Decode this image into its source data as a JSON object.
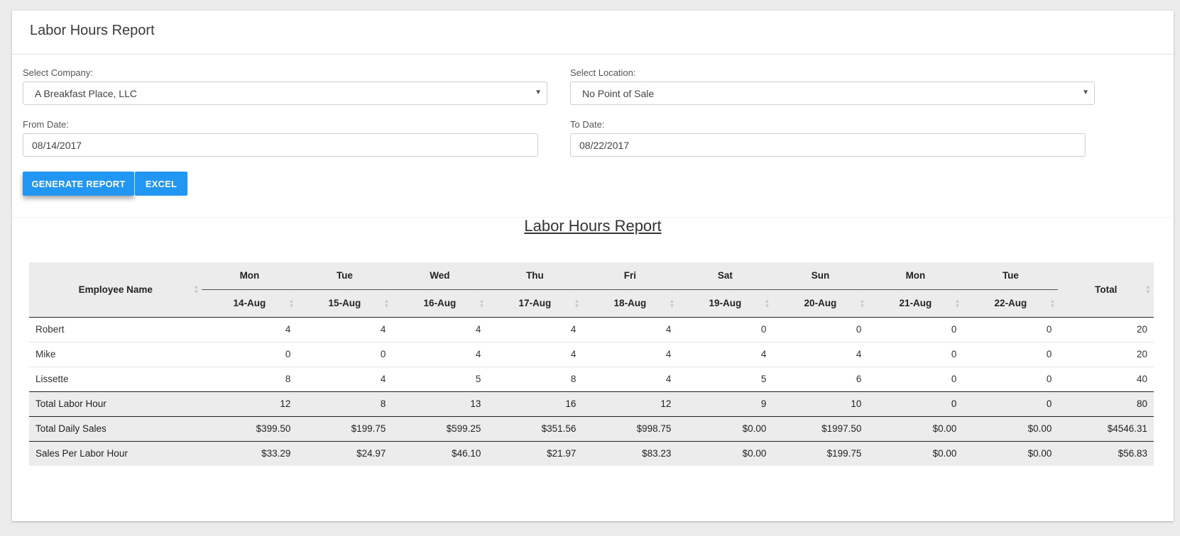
{
  "header": {
    "title": "Labor Hours Report"
  },
  "form": {
    "company_label": "Select Company:",
    "company_value": "A Breakfast Place, LLC",
    "location_label": "Select Location:",
    "location_value": "No Point of Sale",
    "from_label": "From Date:",
    "from_value": "08/14/2017",
    "to_label": "To Date:",
    "to_value": "08/22/2017",
    "generate_label": "GENERATE REPORT",
    "excel_label": "EXCEL"
  },
  "report": {
    "title": "Labor Hours Report",
    "employee_header": "Employee Name",
    "total_header": "Total",
    "days": [
      "Mon",
      "Tue",
      "Wed",
      "Thu",
      "Fri",
      "Sat",
      "Sun",
      "Mon",
      "Tue"
    ],
    "dates": [
      "14-Aug",
      "15-Aug",
      "16-Aug",
      "17-Aug",
      "18-Aug",
      "19-Aug",
      "20-Aug",
      "21-Aug",
      "22-Aug"
    ],
    "rows": [
      {
        "name": "Robert",
        "values": [
          "4",
          "4",
          "4",
          "4",
          "4",
          "0",
          "0",
          "0",
          "0"
        ],
        "total": "20"
      },
      {
        "name": "Mike",
        "values": [
          "0",
          "0",
          "4",
          "4",
          "4",
          "4",
          "4",
          "0",
          "0"
        ],
        "total": "20"
      },
      {
        "name": "Lissette",
        "values": [
          "8",
          "4",
          "5",
          "8",
          "4",
          "5",
          "6",
          "0",
          "0"
        ],
        "total": "40"
      }
    ],
    "summary": [
      {
        "name": "Total Labor Hour",
        "values": [
          "12",
          "8",
          "13",
          "16",
          "12",
          "9",
          "10",
          "0",
          "0"
        ],
        "total": "80"
      },
      {
        "name": "Total Daily Sales",
        "values": [
          "$399.50",
          "$199.75",
          "$599.25",
          "$351.56",
          "$998.75",
          "$0.00",
          "$1997.50",
          "$0.00",
          "$0.00"
        ],
        "total": "$4546.31"
      },
      {
        "name": "Sales Per Labor Hour",
        "values": [
          "$33.29",
          "$24.97",
          "$46.10",
          "$21.97",
          "$83.23",
          "$0.00",
          "$199.75",
          "$0.00",
          "$0.00"
        ],
        "total": "$56.83"
      }
    ]
  }
}
